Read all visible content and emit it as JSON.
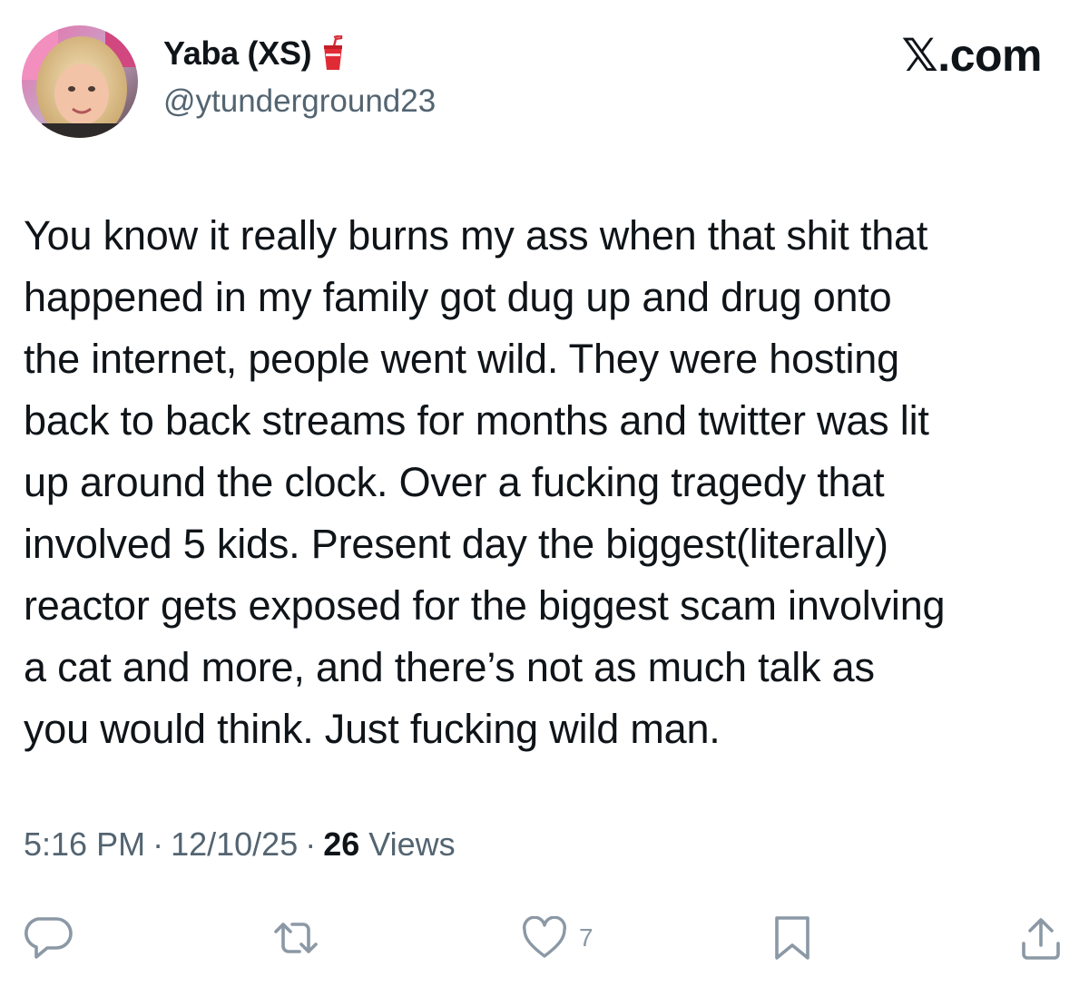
{
  "author": {
    "display_name": "Yaba (XS)",
    "handle": "@ytunderground23",
    "name_emoji": "cup-with-straw-icon"
  },
  "brand": {
    "label": "𝕏.com"
  },
  "tweet": {
    "text": "You know it really burns my ass when that shit that\nhappened in my family got dug up and drug onto\nthe internet, people went wild. They were hosting\nback to back streams for months and twitter was lit\nup around the clock. Over a fucking tragedy that\ninvolved 5 kids. Present day the biggest(literally)\nreactor gets exposed for the biggest scam involving\na cat and more, and there’s not as much talk as\nyou would think. Just fucking wild man.",
    "time": "5:16 PM",
    "date": "12/10/25",
    "separator": "·",
    "views_count": "26",
    "views_label": "Views"
  },
  "actions": {
    "reply_icon": "speech-bubble-icon",
    "retweet_icon": "retweet-icon",
    "like_icon": "heart-icon",
    "like_count": "7",
    "bookmark_icon": "bookmark-icon",
    "share_icon": "share-icon"
  },
  "colors": {
    "text": "#0f1419",
    "secondary": "#536471",
    "action": "#8b98a5",
    "background": "#ffffff"
  }
}
